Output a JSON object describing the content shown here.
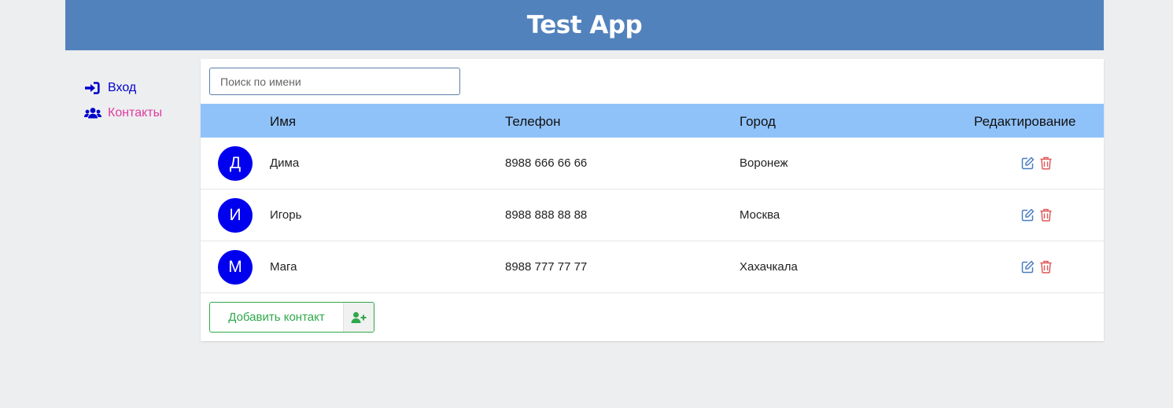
{
  "header": {
    "title": "Test App"
  },
  "sidebar": {
    "items": [
      {
        "label": "Вход",
        "icon": "sign-in-icon",
        "color": "#0000cc"
      },
      {
        "label": "Контакты",
        "icon": "users-icon",
        "color": "#e03ca0"
      }
    ]
  },
  "search": {
    "placeholder": "Поиск по имени",
    "value": ""
  },
  "table": {
    "columns": [
      "Имя",
      "Телефон",
      "Город",
      "Редактирование"
    ],
    "rows": [
      {
        "initial": "Д",
        "name": "Дима",
        "phone": "8988 666 66 66",
        "city": "Воронеж"
      },
      {
        "initial": "И",
        "name": "Игорь",
        "phone": "8988 888 88 88",
        "city": "Москва"
      },
      {
        "initial": "М",
        "name": "Мага",
        "phone": "8988 777 77 77",
        "city": "Хахачкала"
      }
    ]
  },
  "add_button": {
    "label": "Добавить контакт",
    "icon": "user-plus-icon"
  },
  "colors": {
    "header": "#5282bc",
    "table_header": "#90c2fa",
    "avatar": "#0000ee",
    "edit": "#4a7dbf",
    "delete": "#e05a5a",
    "add": "#2ea84a"
  }
}
